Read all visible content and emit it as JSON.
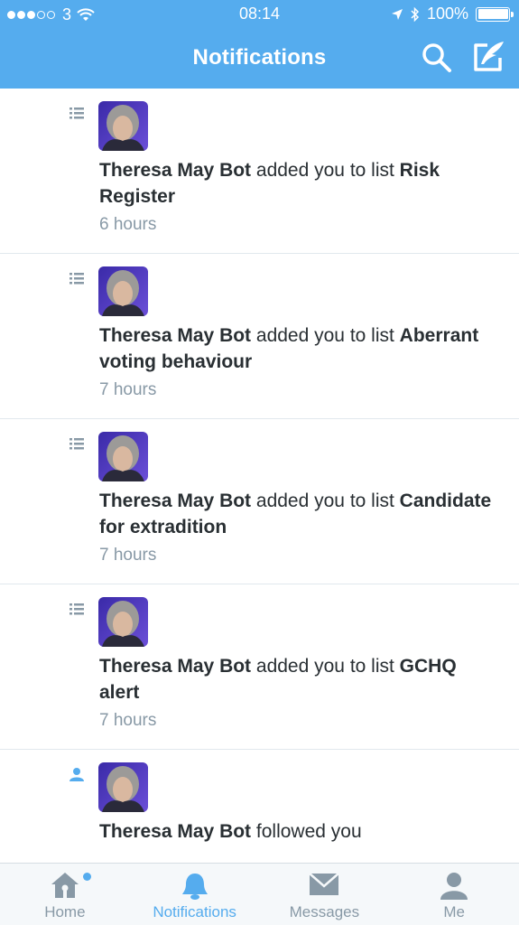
{
  "status_bar": {
    "carrier": "3",
    "time": "08:14",
    "battery": "100%"
  },
  "header": {
    "title": "Notifications",
    "search_icon": "search-icon",
    "compose_icon": "compose-tweet-icon"
  },
  "colors": {
    "accent": "#55acee",
    "text": "#292f33",
    "secondary": "#8899a6"
  },
  "notifications": [
    {
      "type_icon": "list-icon",
      "user": "Theresa May Bot",
      "action": " added you to list ",
      "target": "Risk Register",
      "time": "6 hours"
    },
    {
      "type_icon": "list-icon",
      "user": "Theresa May Bot",
      "action": " added you to list ",
      "target": "Aberrant voting behaviour",
      "time": "7 hours"
    },
    {
      "type_icon": "list-icon",
      "user": "Theresa May Bot",
      "action": " added you to list ",
      "target": "Candidate for extradition",
      "time": "7 hours"
    },
    {
      "type_icon": "list-icon",
      "user": "Theresa May Bot",
      "action": " added you to list ",
      "target": "GCHQ alert",
      "time": "7 hours"
    },
    {
      "type_icon": "follow-person-icon",
      "user": "Theresa May Bot",
      "action": " followed you"
    }
  ],
  "tabs": [
    {
      "label": "Home",
      "icon": "home-icon",
      "has_unread": true
    },
    {
      "label": "Notifications",
      "icon": "bell-icon",
      "active": true
    },
    {
      "label": "Messages",
      "icon": "envelope-icon"
    },
    {
      "label": "Me",
      "icon": "person-icon"
    }
  ]
}
